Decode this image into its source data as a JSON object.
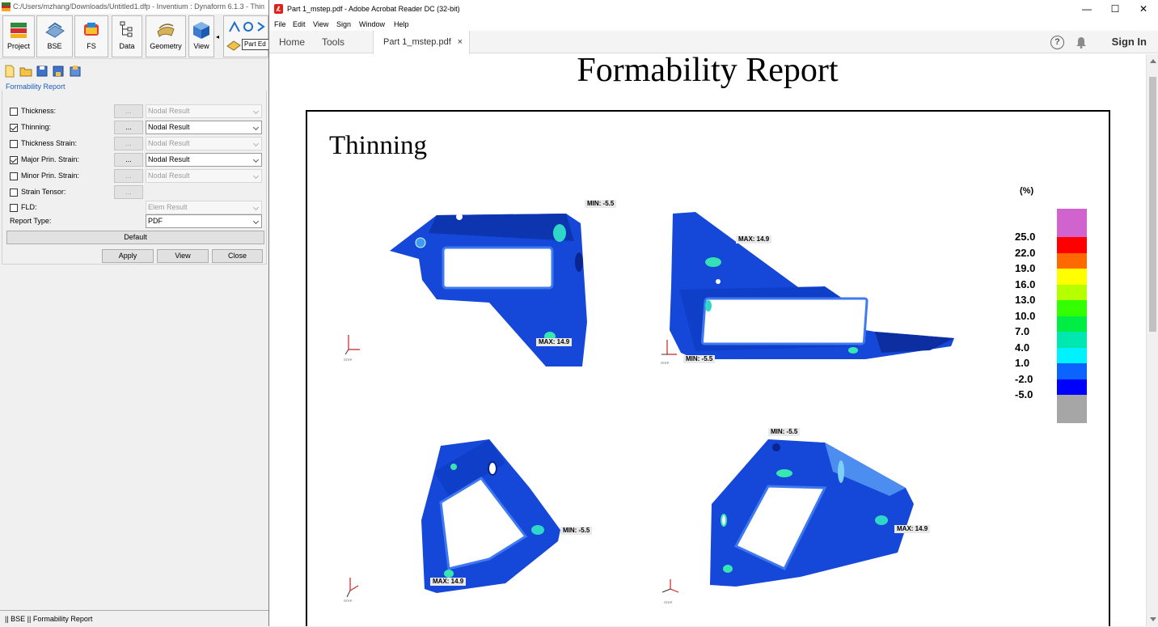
{
  "dynaform": {
    "window_title": "C:/Users/mzhang/Downloads/Untitled1.dfp - Inventium : Dynaform 6.1.3 - Thin",
    "ribbon": [
      {
        "label": "Project",
        "icon": "project-icon"
      },
      {
        "label": "BSE",
        "icon": "bse-icon"
      },
      {
        "label": "FS",
        "icon": "fs-icon"
      },
      {
        "label": "Data",
        "icon": "data-tree-icon"
      },
      {
        "label": "Geometry",
        "icon": "geometry-icon"
      },
      {
        "label": "View",
        "icon": "view-cube-icon"
      }
    ],
    "part_edit_label": "Part Ed",
    "section_title": "Formability Report",
    "rows": [
      {
        "label": "Thickness:",
        "checked": false,
        "dots": "...",
        "select": "Nodal Result",
        "enabled": false
      },
      {
        "label": "Thinning:",
        "checked": true,
        "dots": "...",
        "select": "Nodal Result",
        "enabled": true
      },
      {
        "label": "Thickness Strain:",
        "checked": false,
        "dots": "...",
        "select": "Nodal Result",
        "enabled": false
      },
      {
        "label": "Major Prin. Strain:",
        "checked": true,
        "dots": "...",
        "select": "Nodal Result",
        "enabled": true
      },
      {
        "label": "Minor Prin. Strain:",
        "checked": false,
        "dots": "...",
        "select": "Nodal Result",
        "enabled": false
      },
      {
        "label": "Strain Tensor:",
        "checked": false,
        "dots": "..."
      },
      {
        "label": "FLD:",
        "checked": false,
        "select": "Elem Result",
        "enabled": false
      }
    ],
    "report_type_label": "Report Type:",
    "report_type_value": "PDF",
    "default_button": "Default",
    "apply_button": "Apply",
    "view_button": "View",
    "close_button": "Close",
    "status": "|| BSE || Formability Report"
  },
  "acrobat": {
    "window_title": "Part 1_mstep.pdf - Adobe Acrobat Reader DC (32-bit)",
    "menu": [
      "File",
      "Edit",
      "View",
      "Sign",
      "Window",
      "Help"
    ],
    "tabs": {
      "home": "Home",
      "tools": "Tools",
      "document": "Part 1_mstep.pdf",
      "close": "×"
    },
    "sign_in": "Sign In",
    "window_controls": {
      "minimize": "—",
      "maximize": "☐",
      "close": "✕"
    }
  },
  "report": {
    "title": "Formability Report",
    "section": "Thinning",
    "legend_unit": "(%)",
    "legend_ticks": [
      "25.0",
      "22.0",
      "19.0",
      "16.0",
      "13.0",
      "10.0",
      "7.0",
      "4.0",
      "1.0",
      "-2.0",
      "-5.0"
    ],
    "legend_colors": [
      "#d163cf",
      "#ff0000",
      "#ff6a00",
      "#ffff00",
      "#b6ff00",
      "#33ff00",
      "#00ee44",
      "#00e8b0",
      "#00f2ff",
      "#0c63ff",
      "#0000ff",
      "#a6a6a6"
    ],
    "views": [
      {
        "min": "MIN: -5.5",
        "max": "MAX: 14.9"
      },
      {
        "min": "MIN: -5.5",
        "max": "MAX: 14.9"
      },
      {
        "min": "MIN: -5.5",
        "max": "MAX: 14.9"
      },
      {
        "min": "MIN: -5.5",
        "max": "MAX: 14.9"
      }
    ]
  }
}
